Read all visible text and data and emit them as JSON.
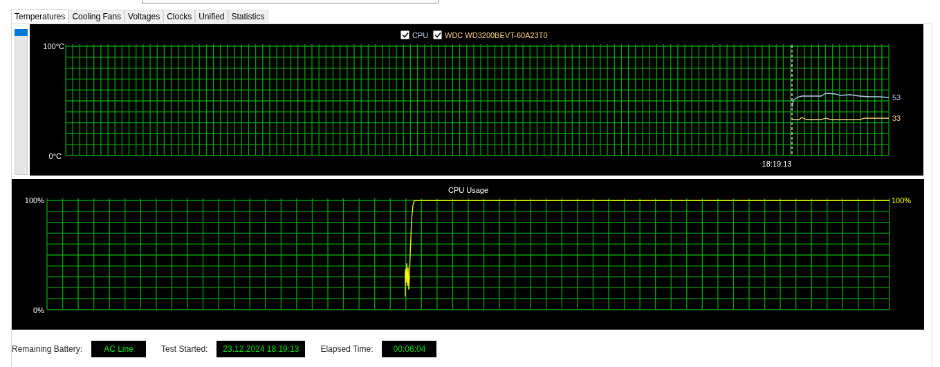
{
  "tabs": [
    {
      "label": "Temperatures",
      "selected": true
    },
    {
      "label": "Cooling Fans",
      "selected": false
    },
    {
      "label": "Voltages",
      "selected": false
    },
    {
      "label": "Clocks",
      "selected": false
    },
    {
      "label": "Unified",
      "selected": false
    },
    {
      "label": "Statistics",
      "selected": false
    }
  ],
  "temperature_graph": {
    "legend": [
      {
        "label": "CPU",
        "checked": true,
        "color": "#b4d2f5",
        "reading": "53"
      },
      {
        "label": "WDC WD3200BEVT-60A23T0",
        "checked": true,
        "color": "#ffd27f",
        "reading": "33"
      }
    ],
    "y_max_label": "100°C",
    "y_min_label": "0°C",
    "time_label": "18:19:13"
  },
  "cpu_graph": {
    "title": "CPU Usage",
    "y_max_label": "100%",
    "y_min_label": "0%",
    "right_label": "100%"
  },
  "status": [
    {
      "label": "Remaining Battery:",
      "value": "AC Line"
    },
    {
      "label": "Test Started:",
      "value": "23.12.2024 18:19:13"
    },
    {
      "label": "Elapsed Time:",
      "value": "00:06:04"
    }
  ]
}
